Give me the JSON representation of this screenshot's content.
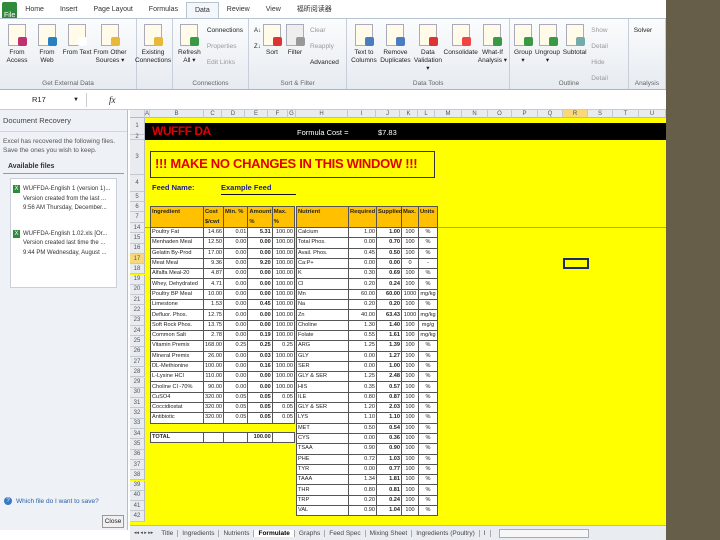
{
  "ribbon": {
    "tabs": [
      "File",
      "Home",
      "Insert",
      "Page Layout",
      "Formulas",
      "Data",
      "Review",
      "View",
      "福昕阅读器"
    ],
    "active_tab": "Data",
    "groups": {
      "external": {
        "label": "Get External Data",
        "buttons": [
          "From Access",
          "From Web",
          "From Text",
          "From Other Sources ▾",
          "Existing Connections"
        ]
      },
      "connections": {
        "label": "Connections",
        "refresh": "Refresh All ▾",
        "items": [
          "Connections",
          "Properties",
          "Edit Links"
        ]
      },
      "sort": {
        "label": "Sort & Filter",
        "sort": "Sort",
        "filter": "Filter",
        "items": [
          "Clear",
          "Reapply",
          "Advanced"
        ]
      },
      "tools": {
        "label": "Data Tools",
        "buttons": [
          "Text to Columns",
          "Remove Duplicates",
          "Data Validation ▾",
          "Consolidate",
          "What-If Analysis ▾"
        ]
      },
      "outline": {
        "label": "Outline",
        "buttons": [
          "Group ▾",
          "Ungroup ▾",
          "Subtotal"
        ],
        "items": [
          "Show Detail",
          "Hide Detail"
        ]
      },
      "analysis": {
        "label": "Analysis",
        "solver": "Solver"
      }
    }
  },
  "formula_bar": {
    "name_box": "R17",
    "fx": "fx",
    "value": ""
  },
  "recovery": {
    "title": "Document Recovery",
    "message": "Excel has recovered the following files.  Save the ones you wish to keep.",
    "available": "Available files",
    "files": [
      {
        "name": "WUFFDA-English 1 (version 1)...",
        "desc": "Version created from the last ...",
        "time": "9:56 AM Thursday, December..."
      },
      {
        "name": "WUFFDA-English 1.02.xls  [Or...",
        "desc": "Version created last time the ...",
        "time": "9:44 PM Wednesday, August ..."
      }
    ],
    "help": "Which file do I want to save?",
    "close": "Close"
  },
  "grid": {
    "columns": [
      "A",
      "B",
      "C",
      "D",
      "E",
      "F",
      "G",
      "H",
      "I",
      "J",
      "K",
      "L",
      "M",
      "N",
      "O",
      "P",
      "Q",
      "R",
      "S",
      "T",
      "U"
    ],
    "rows": [
      "1",
      "2",
      "3",
      "4",
      "5",
      "6",
      "7",
      "14",
      "15",
      "16",
      "17",
      "18",
      "19",
      "20",
      "21",
      "22",
      "23",
      "24",
      "25",
      "26",
      "27",
      "28",
      "29",
      "30",
      "31",
      "32",
      "33",
      "34",
      "35",
      "36",
      "37",
      "38",
      "39",
      "40",
      "41",
      "42"
    ],
    "selected_cell": "R17"
  },
  "sheet": {
    "title": "WUFFF DA",
    "cost_label": "Formula Cost =",
    "cost_value": "$7.83",
    "warning": "!!!  MAKE NO CHANGES IN THIS WINDOW !!!",
    "feed_label": "Feed Name:",
    "feed_value": "Example Feed",
    "ingredients": {
      "headers": [
        "Ingredient",
        "Cost $/cwt",
        "Min. %",
        "Amount %",
        "Max. %"
      ],
      "rows": [
        [
          "Poultry Fat",
          "14.66",
          "0.01",
          "5.31",
          "100.00"
        ],
        [
          "Menhaden Meal",
          "12.50",
          "0.00",
          "0.00",
          "100.00"
        ],
        [
          "Gelatin By-Prod",
          "17.00",
          "0.00",
          "0.00",
          "100.00"
        ],
        [
          "Meat Meal",
          "9.36",
          "0.00",
          "9.20",
          "100.00"
        ],
        [
          "Alfalfa Meal-20",
          "4.87",
          "0.00",
          "0.00",
          "100.00"
        ],
        [
          "Whey, Dehydrated",
          "4.71",
          "0.00",
          "0.00",
          "100.00"
        ],
        [
          "Poultry BP Meal",
          "10.00",
          "0.00",
          "0.00",
          "100.00"
        ],
        [
          "Limestone",
          "1.53",
          "0.00",
          "0.45",
          "100.00"
        ],
        [
          "Defluor. Phos.",
          "12.75",
          "0.00",
          "0.00",
          "100.00"
        ],
        [
          "Soft Rock Phos.",
          "13.75",
          "0.00",
          "0.00",
          "100.00"
        ],
        [
          "Common Salt",
          "2.78",
          "0.00",
          "0.19",
          "100.00"
        ],
        [
          "Vitamin Premix",
          "168.00",
          "0.25",
          "0.25",
          "0.25"
        ],
        [
          "Mineral Premix",
          "26.00",
          "0.00",
          "0.03",
          "100.00"
        ],
        [
          "DL-Methionine",
          "100.00",
          "0.00",
          "0.16",
          "100.00"
        ],
        [
          "L-Lysine HCl",
          "110.00",
          "0.00",
          "0.00",
          "100.00"
        ],
        [
          "Choline Cl -70%",
          "90.00",
          "0.00",
          "0.00",
          "100.00"
        ],
        [
          "CuSO4",
          "320.00",
          "0.05",
          "0.05",
          "0.05"
        ],
        [
          "Coccidiostat",
          "320.00",
          "0.05",
          "0.05",
          "0.05"
        ],
        [
          "Antibiotic",
          "320.00",
          "0.05",
          "0.05",
          "0.05"
        ]
      ],
      "total_label": "TOTAL",
      "total_value": "100.00"
    },
    "nutrients": {
      "headers": [
        "Nutrient",
        "Required",
        "Supplied",
        "Max.",
        "Units"
      ],
      "rows": [
        [
          "Calcium",
          "1.00",
          "1.00",
          "100",
          "%"
        ],
        [
          "Total Phos.",
          "0.00",
          "0.70",
          "100",
          "%"
        ],
        [
          "Avail. Phos.",
          "0.45",
          "0.50",
          "100",
          "%"
        ],
        [
          "Ca:P+",
          "0.00",
          "0.00",
          "0",
          "-"
        ],
        [
          "K",
          "0.30",
          "0.69",
          "100",
          "%"
        ],
        [
          "Cl",
          "0.20",
          "0.24",
          "100",
          "%"
        ],
        [
          "Mn",
          "60.00",
          "60.00",
          "1000",
          "mg/kg"
        ],
        [
          "Na",
          "0.20",
          "0.20",
          "100",
          "%"
        ],
        [
          "Zn",
          "40.00",
          "63.43",
          "1000",
          "mg/kg"
        ],
        [
          "Choline",
          "1.30",
          "1.40",
          "100",
          "mg/g"
        ],
        [
          "Folate",
          "0.55",
          "1.61",
          "100",
          "mg/kg"
        ],
        [
          "ARG",
          "1.25",
          "1.39",
          "100",
          "%"
        ],
        [
          "GLY",
          "0.00",
          "1.27",
          "100",
          "%"
        ],
        [
          "SER",
          "0.00",
          "1.00",
          "100",
          "%"
        ],
        [
          "GLY & SER",
          "1.25",
          "2.48",
          "100",
          "%"
        ],
        [
          "HIS",
          "0.35",
          "0.57",
          "100",
          "%"
        ],
        [
          "ILE",
          "0.80",
          "0.87",
          "100",
          "%"
        ],
        [
          "GLY & SER",
          "1.20",
          "2.03",
          "100",
          "%"
        ],
        [
          "LYS",
          "1.10",
          "1.10",
          "100",
          "%"
        ],
        [
          "MET",
          "0.50",
          "0.54",
          "100",
          "%"
        ],
        [
          "CYS",
          "0.00",
          "0.36",
          "100",
          "%"
        ],
        [
          "TSAA",
          "0.90",
          "0.90",
          "100",
          "%"
        ],
        [
          "PHE",
          "0.72",
          "1.03",
          "100",
          "%"
        ],
        [
          "TYR",
          "0.00",
          "0.77",
          "100",
          "%"
        ],
        [
          "TAAA",
          "1.34",
          "1.81",
          "100",
          "%"
        ],
        [
          "THR",
          "0.80",
          "0.81",
          "100",
          "%"
        ],
        [
          "TRP",
          "0.20",
          "0.24",
          "100",
          "%"
        ],
        [
          "VAL",
          "0.90",
          "1.04",
          "100",
          "%"
        ]
      ]
    }
  },
  "sheet_tabs": {
    "nav": "◂◂ ◂ ▸ ▸▸",
    "tabs": [
      "Title",
      "Ingredients",
      "Nutrients",
      "Formulate",
      "Graphs",
      "Feed Spec",
      "Mixing Sheet",
      "Ingredients (Poultry)",
      "I"
    ],
    "active": "Formulate"
  },
  "colors": {
    "accent": "#ffff00",
    "header": "#ffc000",
    "warning_text": "#e00000",
    "feed_text": "#1a1a9c"
  }
}
